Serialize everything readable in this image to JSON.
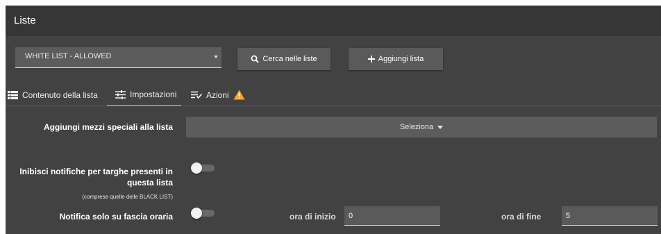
{
  "window": {
    "title": "Liste"
  },
  "toolbar": {
    "list_select_value": "WHITE LIST - ALLOWED",
    "search_label": "Cerca nelle liste",
    "add_label": "Aggiungi lista"
  },
  "tabs": [
    {
      "label": "Contenuto della lista",
      "icon": "list-icon"
    },
    {
      "label": "Impostazioni",
      "icon": "tune-icon",
      "active": true
    },
    {
      "label": "Azioni",
      "icon": "playlist-check-icon",
      "badge_icon": "warning-icon"
    }
  ],
  "settings": {
    "special_vehicles_label": "Aggiungi mezzi speciali alla lista",
    "special_vehicles_button": "Seleziona",
    "inhibit_label_line1": "Inibisci notifiche per targhe presenti in",
    "inhibit_label_line2": "questa lista",
    "inhibit_note": "(comprese quelle delle BLACK LIST)",
    "inhibit_enabled": false,
    "time_notify_label": "Notifica solo su fascia oraria",
    "time_notify_enabled": false,
    "start_label": "ora di inizio",
    "start_value": "0",
    "end_label": "ora di fine",
    "end_value": "5"
  },
  "colors": {
    "background": "#424242",
    "titlebar": "#363636",
    "accent": "#4aa3df",
    "warning": "#f5a623"
  }
}
